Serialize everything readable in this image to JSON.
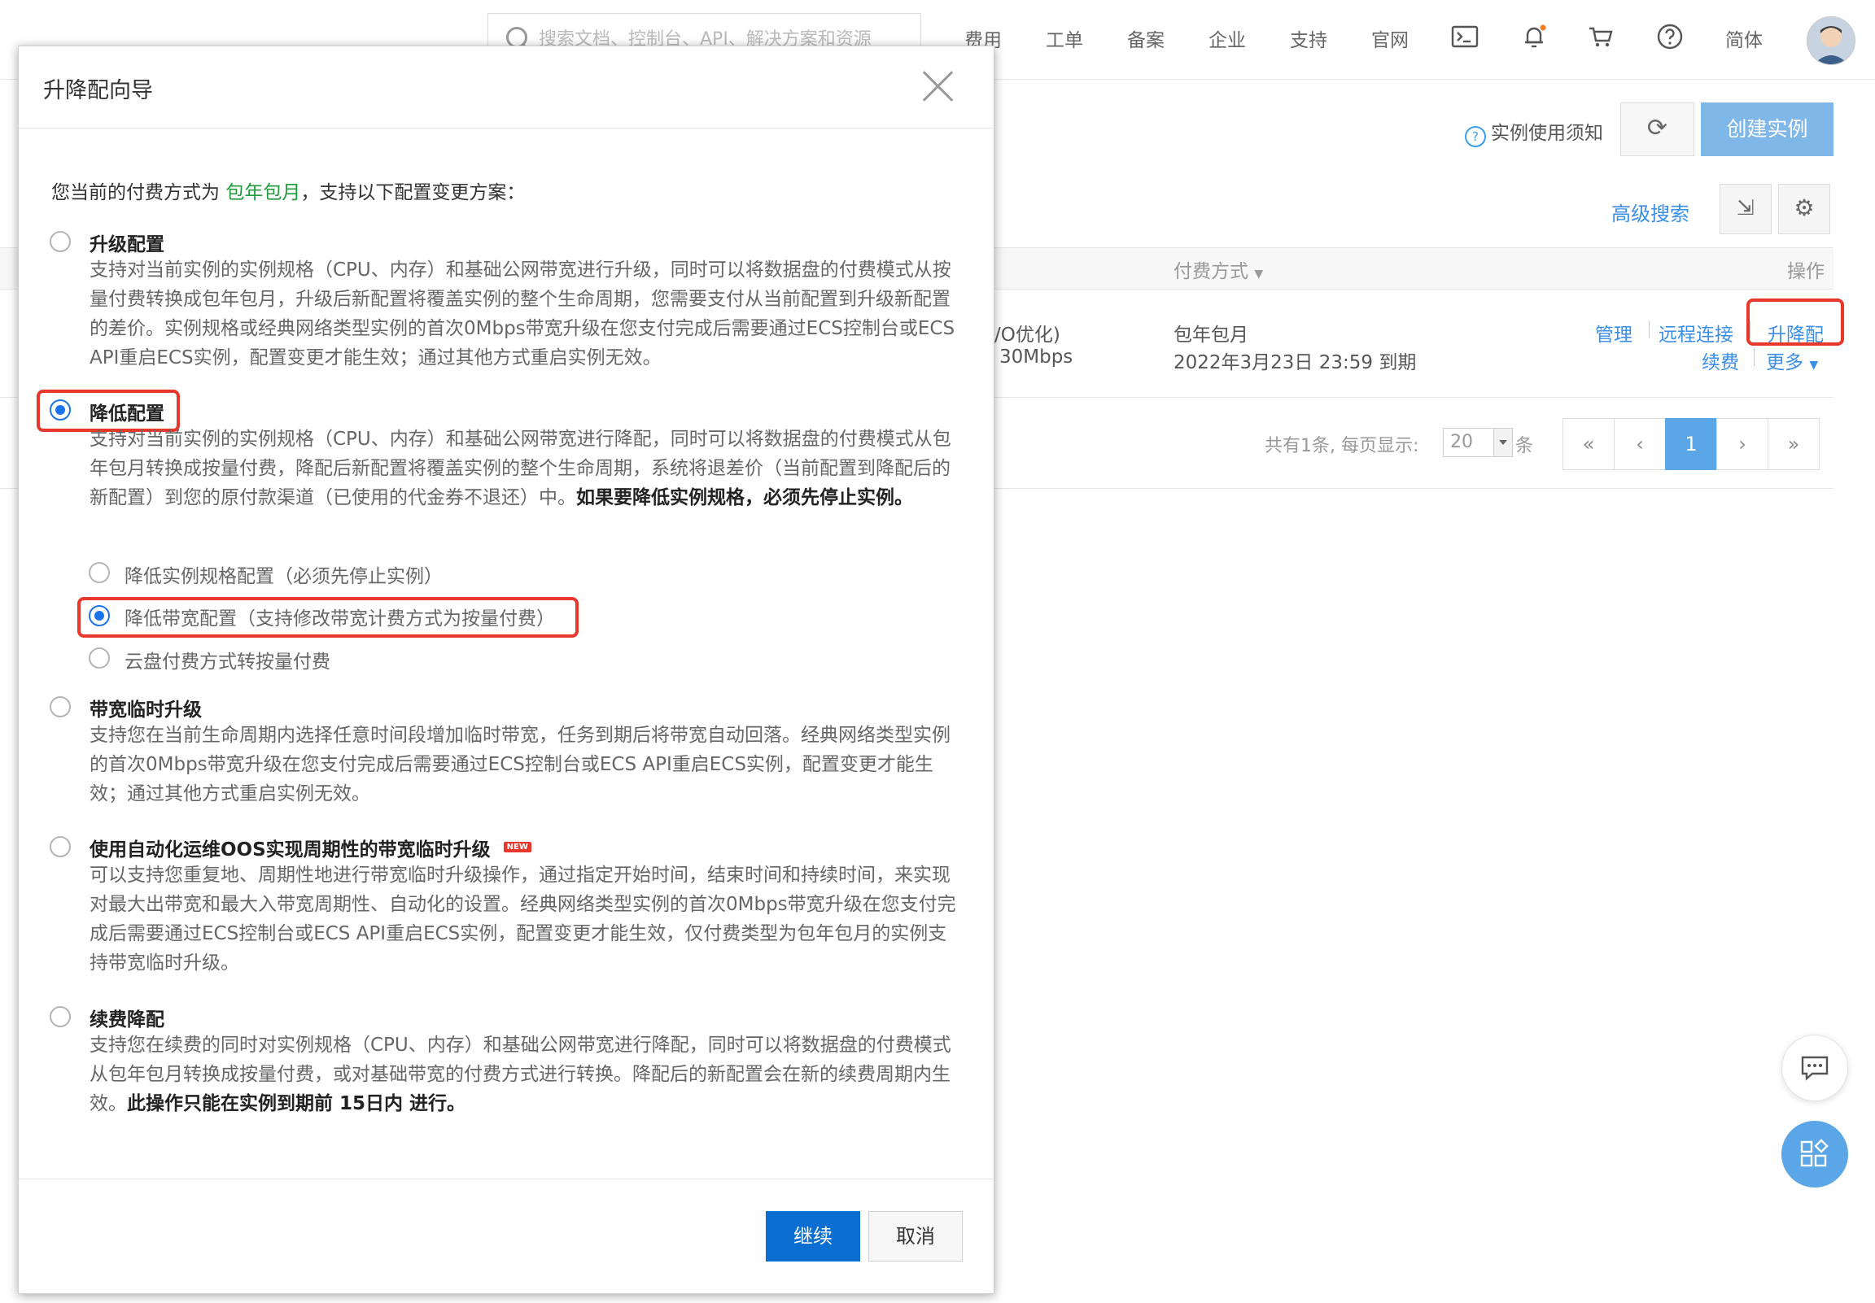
{
  "topbar": {
    "search_placeholder": "搜索文档、控制台、API、解决方案和资源",
    "nav": [
      "费用",
      "工单",
      "备案",
      "企业",
      "支持",
      "官网"
    ],
    "language": "简体",
    "icons": [
      "terminal-icon",
      "bell-icon",
      "cart-icon",
      "help-icon"
    ]
  },
  "toolbar": {
    "help_text": "实例使用须知",
    "create_label": "创建实例",
    "advanced_search": "高级搜索"
  },
  "table": {
    "billing_header": "付费方式",
    "ops_header": "操作",
    "row": {
      "spec_partial": "/O优化)",
      "bandwidth_partial": "30Mbps",
      "billing_type": "包年包月",
      "expiry": "2022年3月23日 23:59 到期",
      "action_manage": "管理",
      "action_remote": "远程连接",
      "action_upgrade": "升降配",
      "action_renew": "续费",
      "action_more": "更多"
    }
  },
  "pagination": {
    "summary": "共有1条, 每页显示:",
    "page_size": "20",
    "unit": "条",
    "buttons": [
      "«",
      "‹",
      "1",
      "›",
      "»"
    ],
    "current_page": "1"
  },
  "modal": {
    "title": "升降配向导",
    "intro_before": "您当前的付费方式为 ",
    "intro_highlight": "包年包月",
    "intro_after": "，支持以下配置变更方案：",
    "options": [
      {
        "title": "升级配置",
        "desc": "支持对当前实例的实例规格（CPU、内存）和基础公网带宽进行升级，同时可以将数据盘的付费模式从按量付费转换成包年包月，升级后新配置将覆盖实例的整个生命周期，您需要支付从当前配置到升级新配置的差价。实例规格或经典网络类型实例的首次0Mbps带宽升级在您支付完成后需要通过ECS控制台或ECS API重启ECS实例，配置变更才能生效；通过其他方式重启实例无效。",
        "checked": false
      },
      {
        "title": "降低配置",
        "desc": "支持对当前实例的实例规格（CPU、内存）和基础公网带宽进行降配，同时可以将数据盘的付费模式从包年包月转换成按量付费，降配后新配置将覆盖实例的整个生命周期，系统将退差价（当前配置到降配后的新配置）到您的原付款渠道（已使用的代金券不退还）中。",
        "desc_bold": "如果要降低实例规格，必须先停止实例。",
        "checked": true,
        "sub_options": [
          {
            "label": "降低实例规格配置（必须先停止实例）",
            "checked": false
          },
          {
            "label": "降低带宽配置（支持修改带宽计费方式为按量付费）",
            "checked": true
          },
          {
            "label": "云盘付费方式转按量付费",
            "checked": false
          }
        ]
      },
      {
        "title": "带宽临时升级",
        "desc": "支持您在当前生命周期内选择任意时间段增加临时带宽，任务到期后将带宽自动回落。经典网络类型实例的首次0Mbps带宽升级在您支付完成后需要通过ECS控制台或ECS API重启ECS实例，配置变更才能生效；通过其他方式重启实例无效。",
        "checked": false
      },
      {
        "title": "使用自动化运维OOS实现周期性的带宽临时升级",
        "badge": "NEW",
        "desc": "可以支持您重复地、周期性地进行带宽临时升级操作，通过指定开始时间，结束时间和持续时间，来实现对最大出带宽和最大入带宽周期性、自动化的设置。经典网络类型实例的首次0Mbps带宽升级在您支付完成后需要通过ECS控制台或ECS API重启ECS实例，配置变更才能生效，仅付费类型为包年包月的实例支持带宽临时升级。",
        "checked": false
      },
      {
        "title": "续费降配",
        "desc": "支持您在续费的同时对实例规格（CPU、内存）和基础公网带宽进行降配，同时可以将数据盘的付费模式从包年包月转换成按量付费，或对基础带宽的付费方式进行转换。降配后的新配置会在新的续费周期内生效。",
        "desc_bold": "此操作只能在实例到期前 15日内 进行。",
        "checked": false
      }
    ],
    "continue_label": "继续",
    "cancel_label": "取消"
  },
  "colors": {
    "accent": "#1a73e8",
    "primary_button": "#0a6fd0",
    "highlight_green": "#1f9b3b",
    "annotation_red": "#e8382c",
    "link": "#3a8ee6"
  }
}
